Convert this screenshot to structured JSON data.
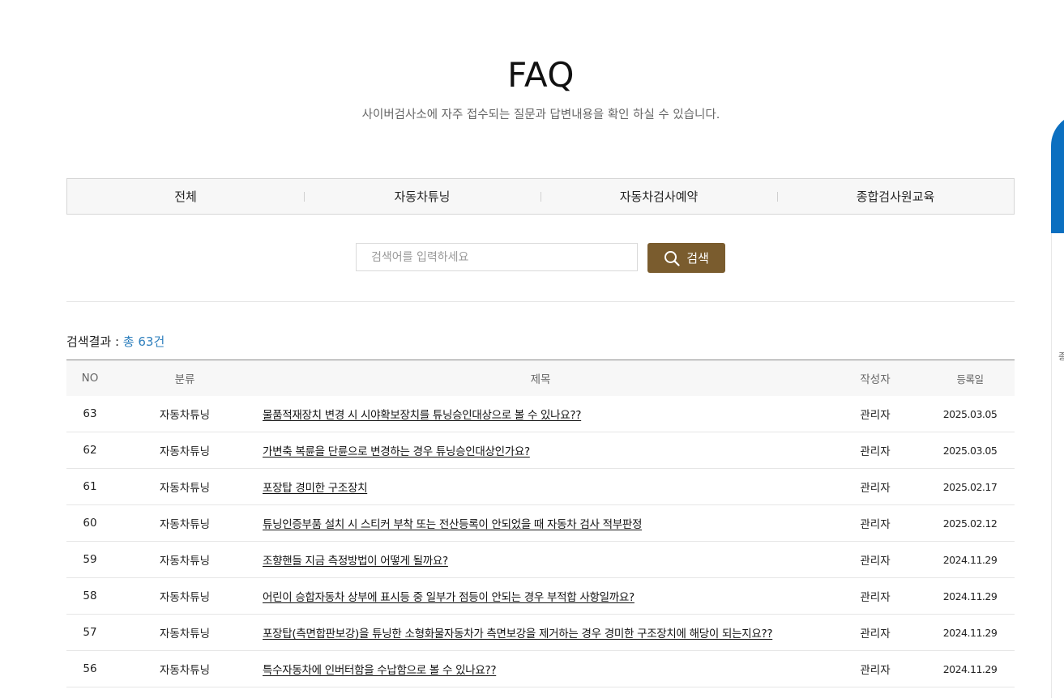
{
  "header": {
    "title": "FAQ",
    "subtitle": "사이버검사소에 자주 접수되는 질문과 답변내용을 확인 하실 수 있습니다."
  },
  "tabs": [
    {
      "label": "전체"
    },
    {
      "label": "자동차튜닝"
    },
    {
      "label": "자동차검사예약"
    },
    {
      "label": "종합검사원교육"
    }
  ],
  "search": {
    "placeholder": "검색어를 입력하세요",
    "button_label": "검색",
    "button_icon": "search-icon"
  },
  "results": {
    "label": "검색결과 : ",
    "total": "총 63건"
  },
  "table": {
    "headers": {
      "no": "NO",
      "category": "분류",
      "title": "제목",
      "author": "작성자",
      "date": "등록일"
    },
    "rows": [
      {
        "no": "63",
        "category": "자동차튜닝",
        "title": "물품적재장치 변경 시 시야확보장치를 튜닝승인대상으로 볼 수 있나요??",
        "author": "관리자",
        "date": "2025.03.05"
      },
      {
        "no": "62",
        "category": "자동차튜닝",
        "title": "가변축 복륜을 단륜으로 변경하는 경우 튜닝승인대상인가요?",
        "author": "관리자",
        "date": "2025.03.05"
      },
      {
        "no": "61",
        "category": "자동차튜닝",
        "title": "포장탑 경미한 구조장치",
        "author": "관리자",
        "date": "2025.02.17"
      },
      {
        "no": "60",
        "category": "자동차튜닝",
        "title": "튜닝인증부품 설치 시 스티커 부착 또는 전산등록이 안되었을 때 자동차 검사 적부판정",
        "author": "관리자",
        "date": "2025.02.12"
      },
      {
        "no": "59",
        "category": "자동차튜닝",
        "title": "조향핸들 지금 측정방법이 어떻게 될까요?",
        "author": "관리자",
        "date": "2024.11.29"
      },
      {
        "no": "58",
        "category": "자동차튜닝",
        "title": "어린이 승합자동차 상부에 표시등 중 일부가 점등이 안되는 경우 부적합 사항일까요?",
        "author": "관리자",
        "date": "2024.11.29"
      },
      {
        "no": "57",
        "category": "자동차튜닝",
        "title": "포장탑(측면합판보강)을 튜닝한 소형화물자동차가 측면보강을 제거하는 경우 경미한 구조장치에 해당이 되는지요??",
        "author": "관리자",
        "date": "2024.11.29"
      },
      {
        "no": "56",
        "category": "자동차튜닝",
        "title": "특수자동차에 인버터함을 수납함으로 볼 수 있나요??",
        "author": "관리자",
        "date": "2024.11.29"
      }
    ]
  },
  "side_widget": {
    "char": "종",
    "color": "#0b6fc0"
  },
  "colors": {
    "accent": "#7a5c2e",
    "total_count": "#2e7fbd"
  }
}
